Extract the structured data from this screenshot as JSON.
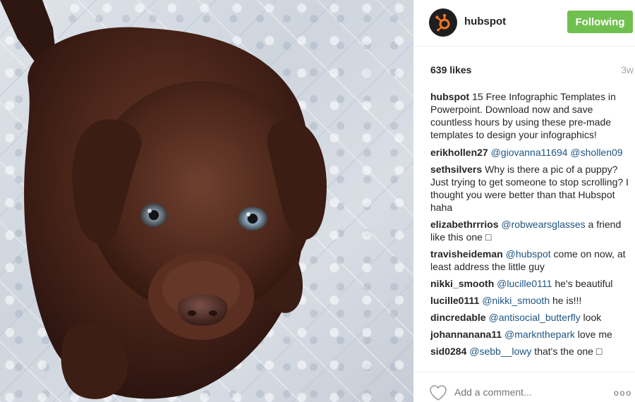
{
  "post": {
    "image_alt": "chocolate labrador puppy on tiled floor",
    "author": "hubspot",
    "follow_label": "Following",
    "likes": "639 likes",
    "age": "3w"
  },
  "caption": {
    "user": "hubspot",
    "text": "15 Free Infographic Templates in Powerpoint. Download now and save countless hours by using these pre-made templates to design your infographics!"
  },
  "comments": [
    {
      "user": "erikhollen27",
      "parts": [
        {
          "t": "m",
          "v": "@giovanna11694"
        },
        {
          "t": "s",
          "v": " "
        },
        {
          "t": "m",
          "v": "@shollen09"
        }
      ]
    },
    {
      "user": "sethsilvers",
      "parts": [
        {
          "t": "s",
          "v": "Why is there a pic of a puppy? Just trying to get someone to stop scrolling? I thought you were better than that Hubspot haha"
        }
      ]
    },
    {
      "user": "elizabethrrrios",
      "parts": [
        {
          "t": "m",
          "v": "@robwearsglasses"
        },
        {
          "t": "s",
          "v": " a friend like this one □"
        }
      ]
    },
    {
      "user": "travisheideman",
      "parts": [
        {
          "t": "m",
          "v": "@hubspot"
        },
        {
          "t": "s",
          "v": " come on now, at least address the little guy"
        }
      ]
    },
    {
      "user": "nikki_smooth",
      "parts": [
        {
          "t": "m",
          "v": "@lucille0111"
        },
        {
          "t": "s",
          "v": " he's beautiful"
        }
      ]
    },
    {
      "user": "lucille0111",
      "parts": [
        {
          "t": "m",
          "v": "@nikki_smooth"
        },
        {
          "t": "s",
          "v": " he is!!!"
        }
      ]
    },
    {
      "user": "dincredable",
      "parts": [
        {
          "t": "m",
          "v": "@antisocial_butterfly"
        },
        {
          "t": "s",
          "v": " look"
        }
      ]
    },
    {
      "user": "johannanana11",
      "parts": [
        {
          "t": "m",
          "v": "@marknthepark"
        },
        {
          "t": "s",
          "v": " love me"
        }
      ]
    },
    {
      "user": "sid0284",
      "parts": [
        {
          "t": "m",
          "v": "@sebb__lowy"
        },
        {
          "t": "s",
          "v": " that's the one □"
        }
      ]
    }
  ],
  "footer": {
    "add_comment_placeholder": "Add a comment...",
    "more_label": "ooo"
  },
  "colors": {
    "follow_green": "#70c050",
    "mention_blue": "#1f5584",
    "muted_gray": "#a5a7aa",
    "hubspot_orange": "#f57722"
  },
  "icons": [
    "hubspot-logo-icon",
    "heart-icon",
    "more-options-icon"
  ]
}
